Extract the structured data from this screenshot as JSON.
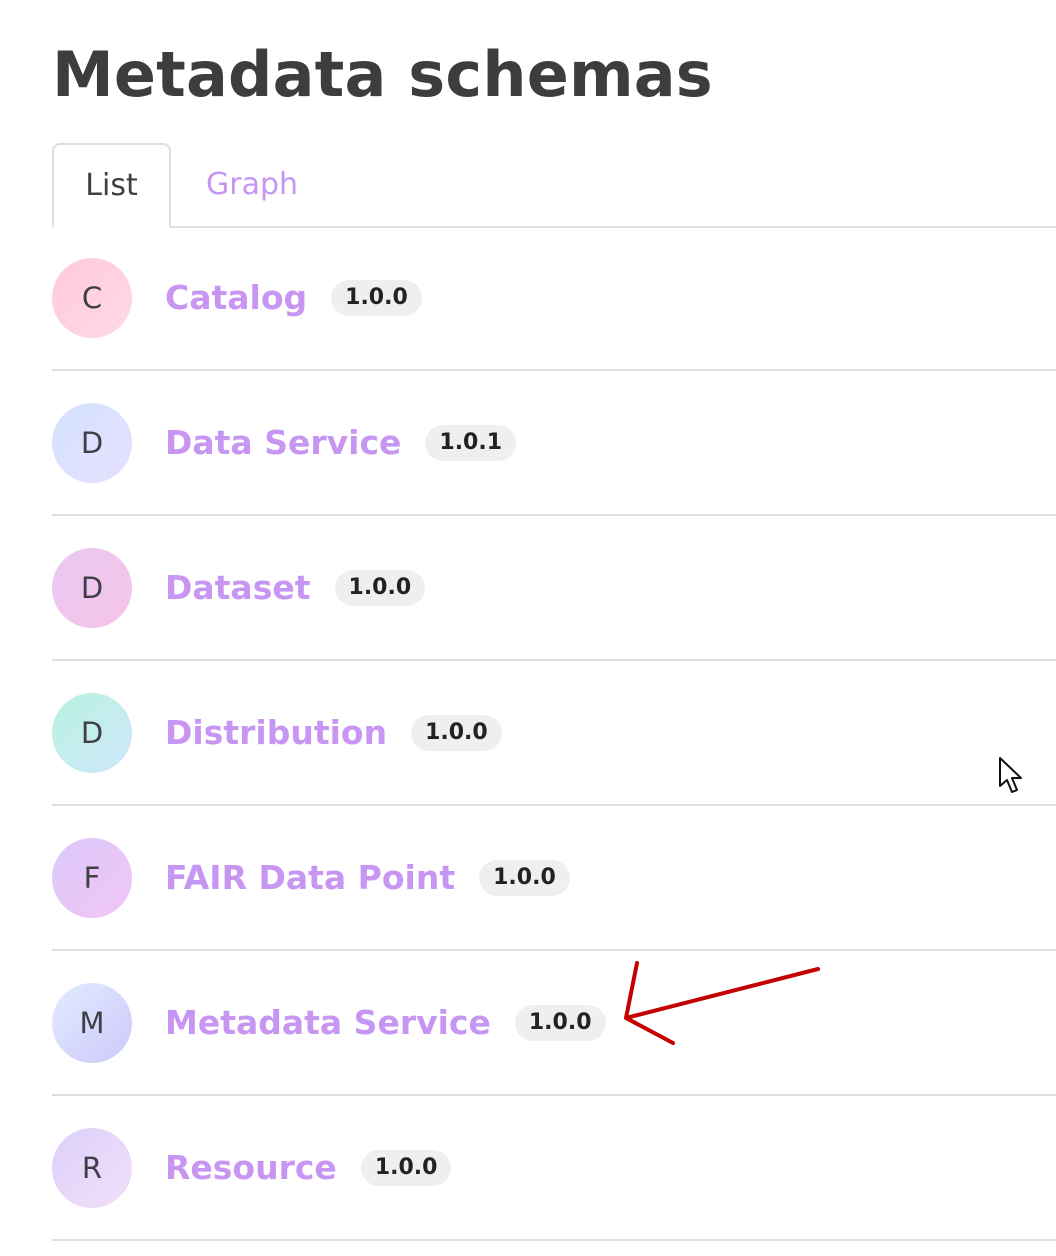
{
  "page": {
    "title": "Metadata schemas"
  },
  "tabs": [
    {
      "label": "List",
      "active": true
    },
    {
      "label": "Graph",
      "active": false
    }
  ],
  "schemas": [
    {
      "initial": "C",
      "name": "Catalog",
      "version": "1.0.0",
      "avatar_gradient": [
        "#ffc9dd",
        "#ffd9e6"
      ]
    },
    {
      "initial": "D",
      "name": "Data Service",
      "version": "1.0.1",
      "avatar_gradient": [
        "#d3e2ff",
        "#e6e0ff"
      ]
    },
    {
      "initial": "D",
      "name": "Dataset",
      "version": "1.0.0",
      "avatar_gradient": [
        "#e9c8f3",
        "#f6c4e6"
      ]
    },
    {
      "initial": "D",
      "name": "Distribution",
      "version": "1.0.0",
      "avatar_gradient": [
        "#b9f3e0",
        "#cfe6fb"
      ]
    },
    {
      "initial": "F",
      "name": "FAIR Data Point",
      "version": "1.0.0",
      "avatar_gradient": [
        "#dcc8fb",
        "#f0c6f5"
      ]
    },
    {
      "initial": "M",
      "name": "Metadata Service",
      "version": "1.0.0",
      "avatar_gradient": [
        "#e2ecff",
        "#ccc8fa"
      ]
    },
    {
      "initial": "R",
      "name": "Resource",
      "version": "1.0.0",
      "avatar_gradient": [
        "#dcd0fb",
        "#f2dff8"
      ]
    }
  ],
  "colors": {
    "link": "#c796f2",
    "annotation_arrow": "#c40000"
  }
}
